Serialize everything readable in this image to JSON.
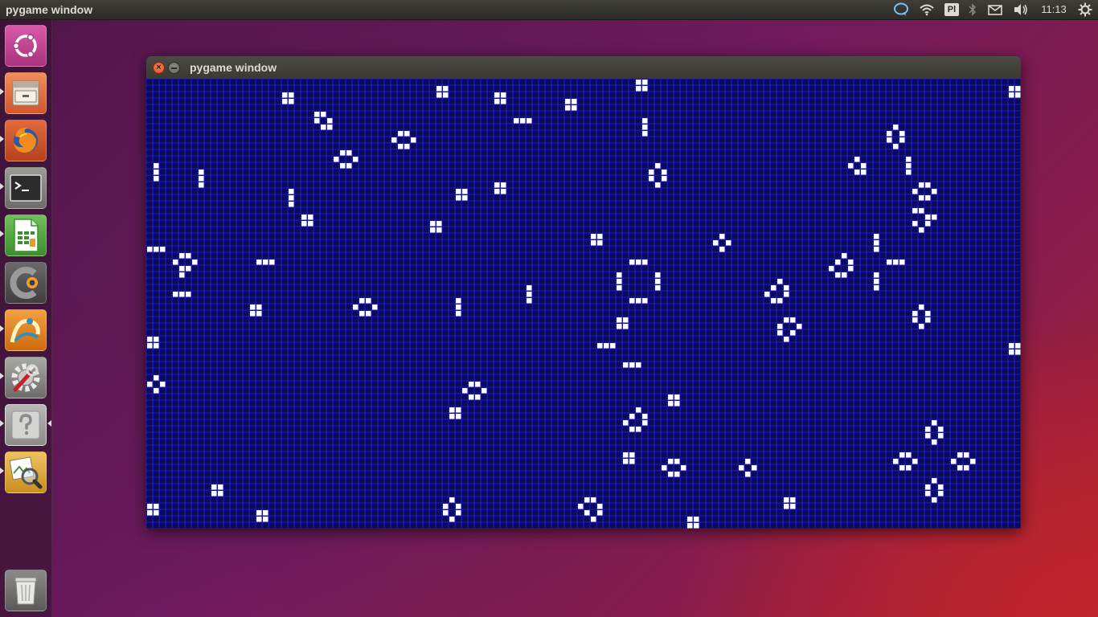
{
  "top_panel": {
    "title": "pygame window",
    "keyboard_layout": "Pl",
    "clock": "11:13",
    "tray_icons": [
      "messaging-icon",
      "wifi-icon",
      "keyboard-layout-indicator",
      "bluetooth-icon",
      "mail-icon",
      "volume-icon",
      "power-gear-icon"
    ]
  },
  "launcher": {
    "items": [
      {
        "name": "dash-home",
        "icon": "ubuntu-logo-icon"
      },
      {
        "name": "files",
        "icon": "file-cabinet-icon",
        "running": true
      },
      {
        "name": "firefox",
        "icon": "firefox-icon",
        "running": true
      },
      {
        "name": "terminal",
        "icon": "terminal-icon",
        "running": true
      },
      {
        "name": "libreoffice-calc",
        "icon": "spreadsheet-icon",
        "running": true
      },
      {
        "name": "qtcreator",
        "icon": "qt-creator-icon"
      },
      {
        "name": "octave",
        "icon": "octave-icon",
        "running": true
      },
      {
        "name": "system-settings",
        "icon": "settings-wrench-icon",
        "running": true
      },
      {
        "name": "help",
        "icon": "question-mark-icon",
        "running": true,
        "focused": true
      },
      {
        "name": "image-viewer",
        "icon": "image-magnifier-icon",
        "running": true
      },
      {
        "name": "trash",
        "icon": "trash-icon"
      }
    ]
  },
  "window": {
    "title": "pygame window",
    "close_glyph": "×",
    "grid": {
      "cols": 136,
      "rows": 70,
      "background": "#0a0a5a",
      "line_color": "#1c1cc8",
      "live_color": "#ffffff",
      "live_cells": [
        [
          76,
          0
        ],
        [
          77,
          0
        ],
        [
          76,
          1
        ],
        [
          77,
          1
        ],
        [
          45,
          1
        ],
        [
          46,
          1
        ],
        [
          45,
          2
        ],
        [
          46,
          2
        ],
        [
          134,
          1
        ],
        [
          135,
          1
        ],
        [
          134,
          2
        ],
        [
          135,
          2
        ],
        [
          21,
          2
        ],
        [
          22,
          2
        ],
        [
          21,
          3
        ],
        [
          22,
          3
        ],
        [
          54,
          2
        ],
        [
          55,
          2
        ],
        [
          54,
          3
        ],
        [
          55,
          3
        ],
        [
          65,
          3
        ],
        [
          66,
          3
        ],
        [
          65,
          4
        ],
        [
          66,
          4
        ],
        [
          26,
          5
        ],
        [
          27,
          5
        ],
        [
          26,
          6
        ],
        [
          28,
          6
        ],
        [
          27,
          7
        ],
        [
          28,
          7
        ],
        [
          57,
          6
        ],
        [
          58,
          6
        ],
        [
          59,
          6
        ],
        [
          77,
          6
        ],
        [
          77,
          7
        ],
        [
          77,
          8
        ],
        [
          116,
          7
        ],
        [
          115,
          8
        ],
        [
          117,
          8
        ],
        [
          115,
          9
        ],
        [
          117,
          9
        ],
        [
          116,
          10
        ],
        [
          39,
          8
        ],
        [
          40,
          8
        ],
        [
          38,
          9
        ],
        [
          41,
          9
        ],
        [
          39,
          10
        ],
        [
          40,
          10
        ],
        [
          30,
          11
        ],
        [
          31,
          11
        ],
        [
          29,
          12
        ],
        [
          32,
          12
        ],
        [
          30,
          13
        ],
        [
          31,
          13
        ],
        [
          118,
          12
        ],
        [
          118,
          13
        ],
        [
          118,
          14
        ],
        [
          110,
          12
        ],
        [
          109,
          13
        ],
        [
          111,
          13
        ],
        [
          110,
          14
        ],
        [
          111,
          14
        ],
        [
          1,
          13
        ],
        [
          1,
          14
        ],
        [
          1,
          15
        ],
        [
          8,
          14
        ],
        [
          8,
          15
        ],
        [
          8,
          16
        ],
        [
          79,
          13
        ],
        [
          78,
          14
        ],
        [
          80,
          14
        ],
        [
          78,
          15
        ],
        [
          80,
          15
        ],
        [
          79,
          16
        ],
        [
          54,
          16
        ],
        [
          55,
          16
        ],
        [
          54,
          17
        ],
        [
          55,
          17
        ],
        [
          120,
          16
        ],
        [
          121,
          16
        ],
        [
          119,
          17
        ],
        [
          122,
          17
        ],
        [
          120,
          18
        ],
        [
          121,
          18
        ],
        [
          48,
          17
        ],
        [
          49,
          17
        ],
        [
          48,
          18
        ],
        [
          49,
          18
        ],
        [
          22,
          17
        ],
        [
          22,
          18
        ],
        [
          22,
          19
        ],
        [
          119,
          20
        ],
        [
          120,
          20
        ],
        [
          121,
          21
        ],
        [
          122,
          21
        ],
        [
          119,
          22
        ],
        [
          121,
          22
        ],
        [
          120,
          23
        ],
        [
          24,
          21
        ],
        [
          25,
          21
        ],
        [
          24,
          22
        ],
        [
          25,
          22
        ],
        [
          44,
          22
        ],
        [
          45,
          22
        ],
        [
          44,
          23
        ],
        [
          45,
          23
        ],
        [
          113,
          24
        ],
        [
          113,
          25
        ],
        [
          113,
          26
        ],
        [
          69,
          24
        ],
        [
          70,
          24
        ],
        [
          69,
          25
        ],
        [
          70,
          25
        ],
        [
          89,
          24
        ],
        [
          88,
          25
        ],
        [
          90,
          25
        ],
        [
          89,
          26
        ],
        [
          0,
          26
        ],
        [
          1,
          26
        ],
        [
          2,
          26
        ],
        [
          5,
          27
        ],
        [
          6,
          27
        ],
        [
          4,
          28
        ],
        [
          7,
          28
        ],
        [
          5,
          29
        ],
        [
          6,
          29
        ],
        [
          5,
          30
        ],
        [
          17,
          28
        ],
        [
          18,
          28
        ],
        [
          19,
          28
        ],
        [
          75,
          28
        ],
        [
          76,
          28
        ],
        [
          77,
          28
        ],
        [
          108,
          27
        ],
        [
          107,
          28
        ],
        [
          109,
          28
        ],
        [
          106,
          29
        ],
        [
          109,
          29
        ],
        [
          107,
          30
        ],
        [
          108,
          30
        ],
        [
          115,
          28
        ],
        [
          116,
          28
        ],
        [
          117,
          28
        ],
        [
          73,
          30
        ],
        [
          73,
          31
        ],
        [
          73,
          32
        ],
        [
          79,
          30
        ],
        [
          79,
          31
        ],
        [
          79,
          32
        ],
        [
          113,
          30
        ],
        [
          113,
          31
        ],
        [
          113,
          32
        ],
        [
          98,
          31
        ],
        [
          97,
          32
        ],
        [
          99,
          32
        ],
        [
          96,
          33
        ],
        [
          99,
          33
        ],
        [
          97,
          34
        ],
        [
          98,
          34
        ],
        [
          4,
          33
        ],
        [
          5,
          33
        ],
        [
          6,
          33
        ],
        [
          59,
          32
        ],
        [
          59,
          33
        ],
        [
          59,
          34
        ],
        [
          75,
          34
        ],
        [
          76,
          34
        ],
        [
          77,
          34
        ],
        [
          33,
          34
        ],
        [
          34,
          34
        ],
        [
          32,
          35
        ],
        [
          35,
          35
        ],
        [
          33,
          36
        ],
        [
          34,
          36
        ],
        [
          48,
          34
        ],
        [
          48,
          35
        ],
        [
          48,
          36
        ],
        [
          16,
          35
        ],
        [
          17,
          35
        ],
        [
          16,
          36
        ],
        [
          17,
          36
        ],
        [
          120,
          35
        ],
        [
          119,
          36
        ],
        [
          121,
          36
        ],
        [
          119,
          37
        ],
        [
          121,
          37
        ],
        [
          120,
          38
        ],
        [
          73,
          37
        ],
        [
          74,
          37
        ],
        [
          73,
          38
        ],
        [
          74,
          38
        ],
        [
          99,
          37
        ],
        [
          100,
          37
        ],
        [
          98,
          38
        ],
        [
          101,
          38
        ],
        [
          98,
          39
        ],
        [
          100,
          39
        ],
        [
          99,
          40
        ],
        [
          0,
          40
        ],
        [
          1,
          40
        ],
        [
          0,
          41
        ],
        [
          1,
          41
        ],
        [
          134,
          41
        ],
        [
          135,
          41
        ],
        [
          134,
          42
        ],
        [
          135,
          42
        ],
        [
          70,
          41
        ],
        [
          71,
          41
        ],
        [
          72,
          41
        ],
        [
          74,
          44
        ],
        [
          75,
          44
        ],
        [
          76,
          44
        ],
        [
          1,
          46
        ],
        [
          0,
          47
        ],
        [
          2,
          47
        ],
        [
          1,
          48
        ],
        [
          50,
          47
        ],
        [
          51,
          47
        ],
        [
          49,
          48
        ],
        [
          52,
          48
        ],
        [
          50,
          49
        ],
        [
          51,
          49
        ],
        [
          81,
          49
        ],
        [
          82,
          49
        ],
        [
          81,
          50
        ],
        [
          82,
          50
        ],
        [
          47,
          51
        ],
        [
          48,
          51
        ],
        [
          47,
          52
        ],
        [
          48,
          52
        ],
        [
          76,
          51
        ],
        [
          75,
          52
        ],
        [
          77,
          52
        ],
        [
          74,
          53
        ],
        [
          77,
          53
        ],
        [
          75,
          54
        ],
        [
          76,
          54
        ],
        [
          122,
          53
        ],
        [
          121,
          54
        ],
        [
          123,
          54
        ],
        [
          121,
          55
        ],
        [
          123,
          55
        ],
        [
          122,
          56
        ],
        [
          74,
          58
        ],
        [
          75,
          58
        ],
        [
          74,
          59
        ],
        [
          75,
          59
        ],
        [
          81,
          59
        ],
        [
          82,
          59
        ],
        [
          80,
          60
        ],
        [
          83,
          60
        ],
        [
          81,
          61
        ],
        [
          82,
          61
        ],
        [
          93,
          59
        ],
        [
          92,
          60
        ],
        [
          94,
          60
        ],
        [
          93,
          61
        ],
        [
          117,
          58
        ],
        [
          118,
          58
        ],
        [
          116,
          59
        ],
        [
          119,
          59
        ],
        [
          117,
          60
        ],
        [
          118,
          60
        ],
        [
          126,
          58
        ],
        [
          127,
          58
        ],
        [
          125,
          59
        ],
        [
          128,
          59
        ],
        [
          126,
          60
        ],
        [
          127,
          60
        ],
        [
          122,
          62
        ],
        [
          121,
          63
        ],
        [
          123,
          63
        ],
        [
          121,
          64
        ],
        [
          123,
          64
        ],
        [
          122,
          65
        ],
        [
          10,
          63
        ],
        [
          11,
          63
        ],
        [
          10,
          64
        ],
        [
          11,
          64
        ],
        [
          68,
          65
        ],
        [
          69,
          65
        ],
        [
          67,
          66
        ],
        [
          70,
          66
        ],
        [
          68,
          67
        ],
        [
          70,
          67
        ],
        [
          69,
          68
        ],
        [
          47,
          65
        ],
        [
          46,
          66
        ],
        [
          48,
          66
        ],
        [
          46,
          67
        ],
        [
          48,
          67
        ],
        [
          47,
          68
        ],
        [
          99,
          65
        ],
        [
          100,
          65
        ],
        [
          99,
          66
        ],
        [
          100,
          66
        ],
        [
          0,
          66
        ],
        [
          1,
          66
        ],
        [
          0,
          67
        ],
        [
          1,
          67
        ],
        [
          17,
          67
        ],
        [
          18,
          67
        ],
        [
          17,
          68
        ],
        [
          18,
          68
        ],
        [
          84,
          68
        ],
        [
          85,
          68
        ],
        [
          84,
          69
        ],
        [
          85,
          69
        ]
      ]
    }
  }
}
